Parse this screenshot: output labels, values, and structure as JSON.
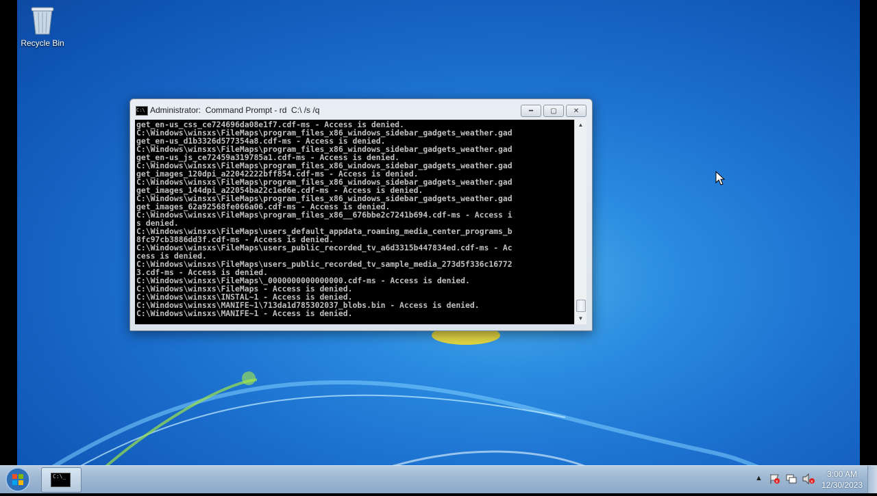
{
  "desktop": {
    "icons": [
      {
        "label": "Recycle Bin",
        "icon": "recycle-bin-icon"
      }
    ]
  },
  "window": {
    "title": "Administrator:  Command Prompt - rd  C:\\ /s /q",
    "icon": "cmd-icon",
    "controls": [
      "minimize",
      "maximize",
      "close"
    ],
    "console_lines": [
      "get_en-us_css_ce724696da08e1f7.cdf-ms - Access is denied.",
      "C:\\Windows\\winsxs\\FileMaps\\program_files_x86_windows_sidebar_gadgets_weather.gad",
      "get_en-us_d1b3326d577354a8.cdf-ms - Access is denied.",
      "C:\\Windows\\winsxs\\FileMaps\\program_files_x86_windows_sidebar_gadgets_weather.gad",
      "get_en-us_js_ce72459a319785a1.cdf-ms - Access is denied.",
      "C:\\Windows\\winsxs\\FileMaps\\program_files_x86_windows_sidebar_gadgets_weather.gad",
      "get_images_120dpi_a22042222bff854.cdf-ms - Access is denied.",
      "C:\\Windows\\winsxs\\FileMaps\\program_files_x86_windows_sidebar_gadgets_weather.gad",
      "get_images_144dpi_a22054ba22c1ed6e.cdf-ms - Access is denied.",
      "C:\\Windows\\winsxs\\FileMaps\\program_files_x86_windows_sidebar_gadgets_weather.gad",
      "get_images_62a92568fe066a06.cdf-ms - Access is denied.",
      "C:\\Windows\\winsxs\\FileMaps\\program_files_x86__676bbe2c7241b694.cdf-ms - Access i",
      "s denied.",
      "C:\\Windows\\winsxs\\FileMaps\\users_default_appdata_roaming_media_center_programs_b",
      "8fc97cb3886dd3f.cdf-ms - Access is denied.",
      "C:\\Windows\\winsxs\\FileMaps\\users_public_recorded_tv_a6d3315b447834ed.cdf-ms - Ac",
      "cess is denied.",
      "C:\\Windows\\winsxs\\FileMaps\\users_public_recorded_tv_sample_media_273d5f336c16772",
      "3.cdf-ms - Access is denied.",
      "C:\\Windows\\winsxs\\FileMaps\\_0000000000000000.cdf-ms - Access is denied.",
      "C:\\Windows\\winsxs\\FileMaps - Access is denied.",
      "C:\\Windows\\winsxs\\INSTAL~1 - Access is denied.",
      "C:\\Windows\\winsxs\\MANIFE~1\\713da1d785302037_blobs.bin - Access is denied.",
      "C:\\Windows\\winsxs\\MANIFE~1 - Access is denied."
    ]
  },
  "taskbar": {
    "start_icon": "windows-start-icon",
    "task_icon": "cmd-icon",
    "tray_icons": [
      "show-hidden-icons-chevron",
      "action-center-flag-icon",
      "network-icon",
      "volume-muted-icon"
    ],
    "time": "3:00 AM",
    "date": "12/30/2023"
  },
  "colors": {
    "console_bg": "#000000",
    "console_fg": "#c0c0c0",
    "desktop_blue": "#1a6ccc"
  }
}
